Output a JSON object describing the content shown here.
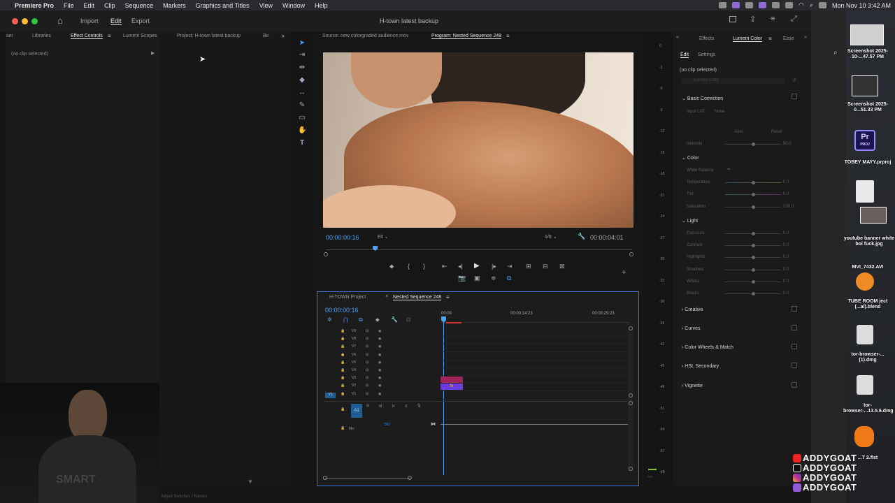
{
  "menubar": {
    "app": "Premiere Pro",
    "items": [
      "File",
      "Edit",
      "Clip",
      "Sequence",
      "Markers",
      "Graphics and Titles",
      "View",
      "Window",
      "Help"
    ],
    "datetime": "Mon Nov 10  3:42 AM"
  },
  "window": {
    "title": "H-town latest backup",
    "workspace_tabs": [
      "Import",
      "Edit",
      "Export"
    ]
  },
  "left_panel": {
    "tabs": [
      "ser",
      "Libraries",
      "Effect Controls",
      "Lumetri Scopes",
      "Project: H-town latest backup",
      "Bir"
    ],
    "no_clip": "(no clip selected)",
    "bottom_text": "Adjust Switches / Names"
  },
  "source_tab": "Source: new colorgraded audience.mov",
  "program_tab": "Program: Nested Sequence 248",
  "program": {
    "timecode": "00:00:00:16",
    "fit": "Fit",
    "resolution": "1/8",
    "duration": "00:00:04:01",
    "playhead_fraction": 0.16
  },
  "timeline": {
    "tabs": [
      "H-TOWN Project",
      "Nested Sequence 248"
    ],
    "timecode": "00:00:00:16",
    "ruler": [
      "00:00",
      "00:00:14:23",
      "00:00:29:23"
    ],
    "tracks": [
      "V9",
      "V8",
      "V7",
      "V6",
      "V5",
      "V4",
      "V3",
      "V2",
      "V1"
    ],
    "audio": [
      "A1"
    ],
    "audio_buttons": [
      "M",
      "R",
      "S"
    ],
    "mix": "Mix",
    "mix_value": "0.0",
    "clip_fx": "fx"
  },
  "meter_scale": [
    "0",
    "-3",
    "-6",
    "-9",
    "-12",
    "-15",
    "-18",
    "-21",
    "-24",
    "-27",
    "-30",
    "-33",
    "-36",
    "-39",
    "-42",
    "-45",
    "-48",
    "-51",
    "-54",
    "-57",
    "-dB"
  ],
  "lumetri": {
    "tabs": [
      "Effects",
      "Lumetri Color",
      "Esse"
    ],
    "sub_tabs": [
      "Edit",
      "Settings"
    ],
    "no_clip": "(no clip selected)",
    "fx_label": "Lumetri Color",
    "sections": {
      "basic": "Basic Correction",
      "input_lut_label": "Input LUT",
      "input_lut_value": "None",
      "auto": "Auto",
      "reset": "Reset",
      "intensity_label": "Intensity",
      "intensity_value": "50.0",
      "color": "Color",
      "white_balance": "White Balance",
      "temperature": "Temperature",
      "temperature_value": "0.0",
      "tint": "Tint",
      "tint_value": "0.0",
      "saturation": "Saturation",
      "saturation_value": "100.0",
      "light": "Light",
      "exposure": "Exposure",
      "contrast": "Contrast",
      "highlights": "Highlights",
      "shadows": "Shadows",
      "whites": "Whites",
      "blacks": "Blacks",
      "light_value": "0.0",
      "creative": "Creative",
      "curves": "Curves",
      "wheels": "Color Wheels & Match",
      "hsl": "HSL Secondary",
      "vignette": "Vignette"
    }
  },
  "desktop": {
    "items": [
      "Screenshot 2025-10-...47.57 PM",
      "Screenshot 2025-0...51.33 PM",
      "TOBEY MAYY.prproj",
      "PROJ",
      "youtube banner white boi fuck.jpg",
      "MVI_7432.AVI",
      "TUBE ROOM ject (...al).blend",
      "tor-browser-...(1).dmg",
      "tor-browser-...13.5.6.dmg",
      "...T 2.flst"
    ],
    "handle": "ADDYGOAT"
  },
  "colors": {
    "accent": "#4aa3ff",
    "clip": "#a0235a",
    "fx": "#6b3be0",
    "selection": "#3a78d8"
  }
}
